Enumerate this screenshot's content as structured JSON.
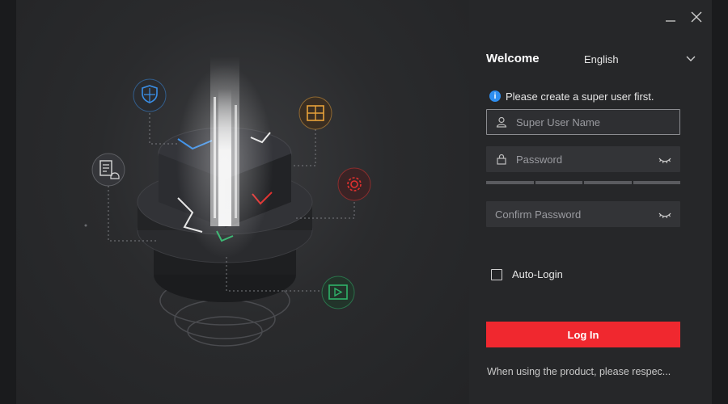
{
  "window": {
    "minimize_icon": "minimize-icon",
    "close_icon": "close-icon"
  },
  "hero": {
    "icons": [
      "shield-icon",
      "grid-window-icon",
      "document-bell-icon",
      "gear-icon",
      "video-play-icon"
    ],
    "accent_colors": {
      "shield": "#3a8ee6",
      "grid": "#e8a23a",
      "gear": "#e0312f",
      "video": "#2fb36a"
    }
  },
  "login": {
    "welcome": "Welcome",
    "language": "English",
    "info_text": "Please create a super user first.",
    "username_placeholder": "Super User Name",
    "username_value": "",
    "password_placeholder": "Password",
    "password_value": "",
    "confirm_placeholder": "Confirm Password",
    "confirm_value": "",
    "auto_login_label": "Auto-Login",
    "auto_login_checked": false,
    "login_button": "Log In",
    "footer_note": "When using the product, please respec..."
  },
  "colors": {
    "primary": "#f0282f",
    "info": "#2e8ef0",
    "background": "#262729"
  }
}
